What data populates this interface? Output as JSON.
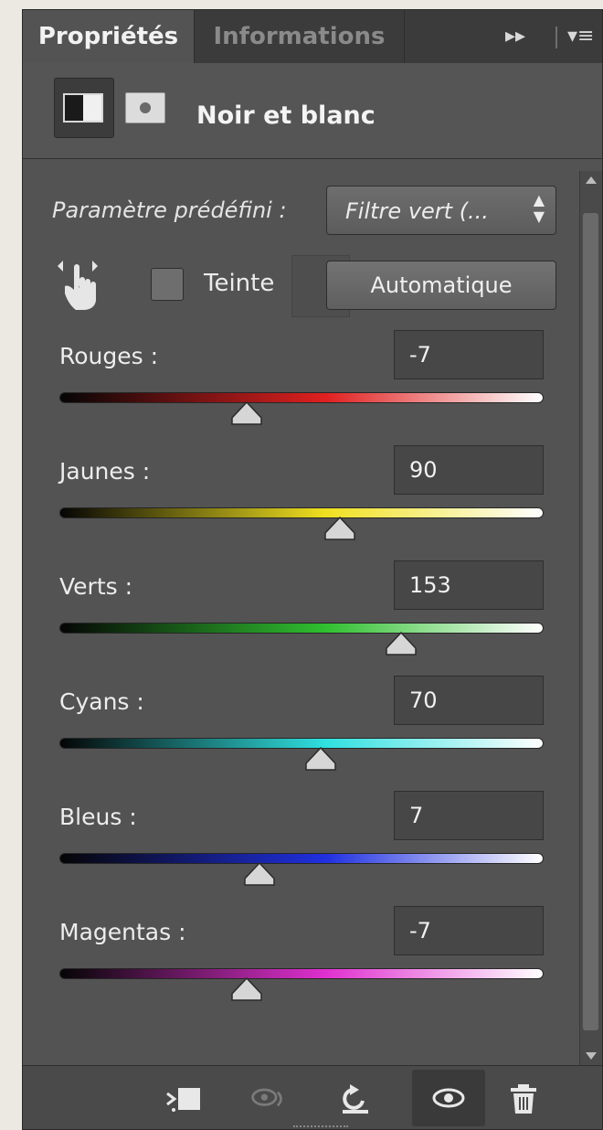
{
  "tabs": {
    "properties": "Propriétés",
    "information": "Informations"
  },
  "tab_controls": {
    "collapse": "▸▸",
    "menu": "▾≡"
  },
  "header": {
    "title": "Noir et blanc"
  },
  "preset": {
    "label": "Paramètre prédéfini :",
    "value": "Filtre vert (..."
  },
  "tint": {
    "label": "Teinte",
    "checked": false
  },
  "auto_button": "Automatique",
  "channels": [
    {
      "label": "Rouges :",
      "value": "-7",
      "color": "#e02020"
    },
    {
      "label": "Jaunes :",
      "value": "90",
      "color": "#f0e020"
    },
    {
      "label": "Verts :",
      "value": "153",
      "color": "#30c030"
    },
    {
      "label": "Cyans :",
      "value": "70",
      "color": "#30e0e0"
    },
    {
      "label": "Bleus :",
      "value": "7",
      "color": "#2030e0"
    },
    {
      "label": "Magentas :",
      "value": "-7",
      "color": "#e030d0"
    }
  ],
  "slider_range": [
    -200,
    300
  ],
  "icons": {
    "hand": "targeted-adjustment-hand-icon",
    "clip": "clip-to-layer-icon",
    "view_previous": "view-previous-state-icon",
    "reset": "reset-icon",
    "visibility": "visibility-eye-icon",
    "delete": "trash-icon"
  }
}
